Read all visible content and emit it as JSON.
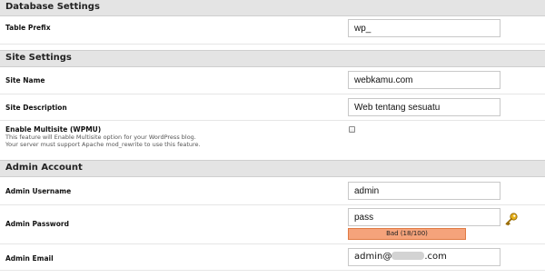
{
  "database_settings": {
    "title": "Database Settings",
    "table_prefix": {
      "label": "Table Prefix",
      "value": "wp_"
    }
  },
  "site_settings": {
    "title": "Site Settings",
    "site_name": {
      "label": "Site Name",
      "value": "webkamu.com"
    },
    "site_description": {
      "label": "Site Description",
      "value": "Web tentang sesuatu"
    },
    "multisite": {
      "label": "Enable Multisite (WPMU)",
      "hint_line1": "This feature will Enable Multisite option for your WordPress blog.",
      "hint_line2": "Your server must support Apache mod_rewrite to use this feature.",
      "checked": false
    }
  },
  "admin_account": {
    "title": "Admin Account",
    "username": {
      "label": "Admin Username",
      "value": "admin"
    },
    "password": {
      "label": "Admin Password",
      "value": "pass",
      "strength_text": "Bad (18/100)",
      "strength_color": "#f5a37b"
    },
    "email": {
      "label": "Admin Email",
      "value_prefix": "admin@",
      "value_suffix": ".com"
    }
  },
  "icons": {
    "password_generate": "key-icon"
  }
}
